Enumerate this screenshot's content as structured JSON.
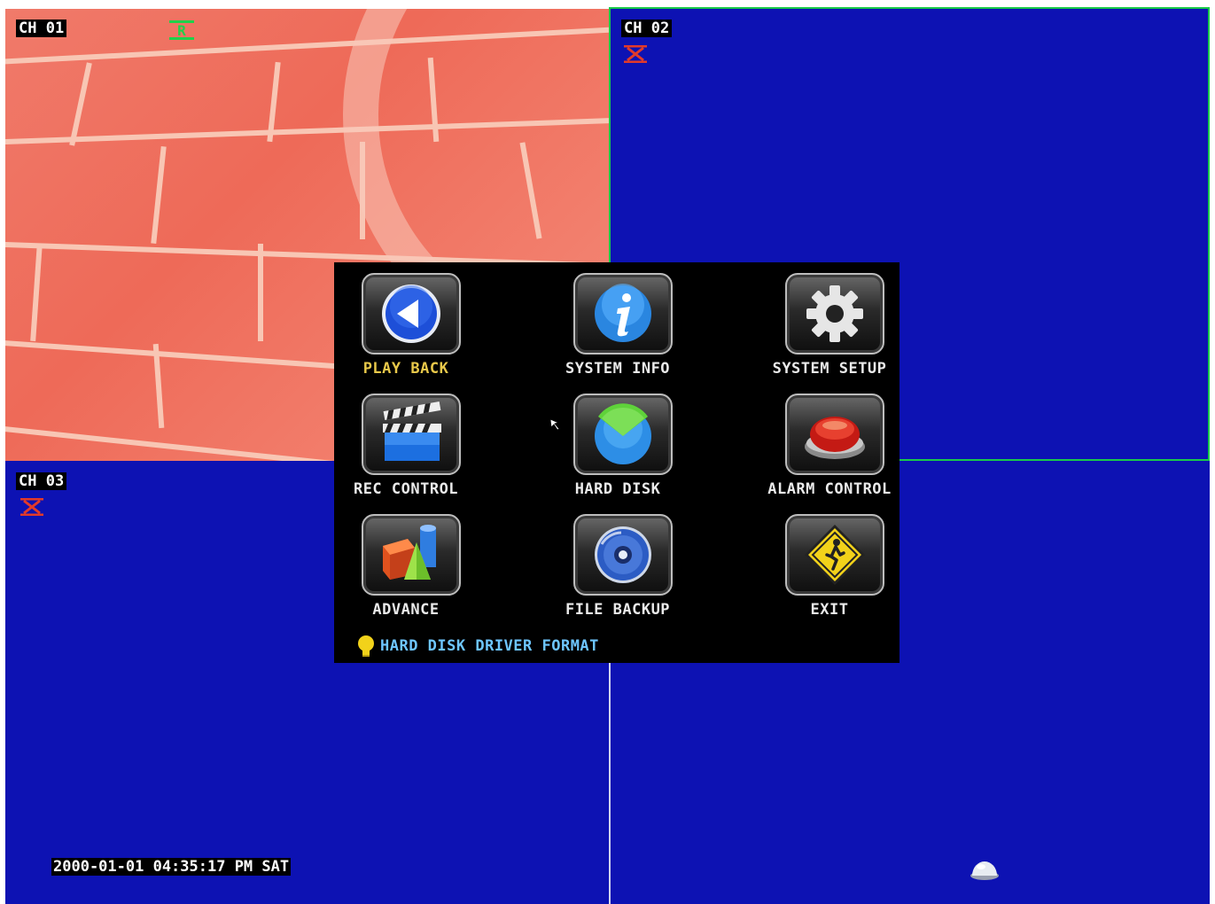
{
  "channels": {
    "ch1": {
      "label": "CH 01",
      "status": "record"
    },
    "ch2": {
      "label": "CH 02",
      "status": "no-signal"
    },
    "ch3": {
      "label": "CH 03",
      "status": "no-signal"
    }
  },
  "menu": {
    "items": [
      {
        "label": "PLAY BACK",
        "icon": "playback-icon"
      },
      {
        "label": "SYSTEM INFO",
        "icon": "info-icon"
      },
      {
        "label": "SYSTEM SETUP",
        "icon": "gear-icon"
      },
      {
        "label": "REC CONTROL",
        "icon": "clapperboard-icon"
      },
      {
        "label": "HARD DISK",
        "icon": "hard-disk-icon"
      },
      {
        "label": "ALARM CONTROL",
        "icon": "alarm-button-icon"
      },
      {
        "label": "ADVANCE",
        "icon": "shapes-icon"
      },
      {
        "label": "FILE BACKUP",
        "icon": "dvd-icon"
      },
      {
        "label": "EXIT",
        "icon": "exit-sign-icon"
      }
    ],
    "selected": "PLAY BACK",
    "hint": "HARD DISK DRIVER FORMAT"
  },
  "status_bar": {
    "datetime": "2000-01-01 04:35:17 PM SAT"
  },
  "colors": {
    "no_signal_bg": "#0d12b3",
    "active_border": "#19c94a",
    "selected_label": "#e8c84a",
    "hint_text": "#6ec6ff"
  }
}
